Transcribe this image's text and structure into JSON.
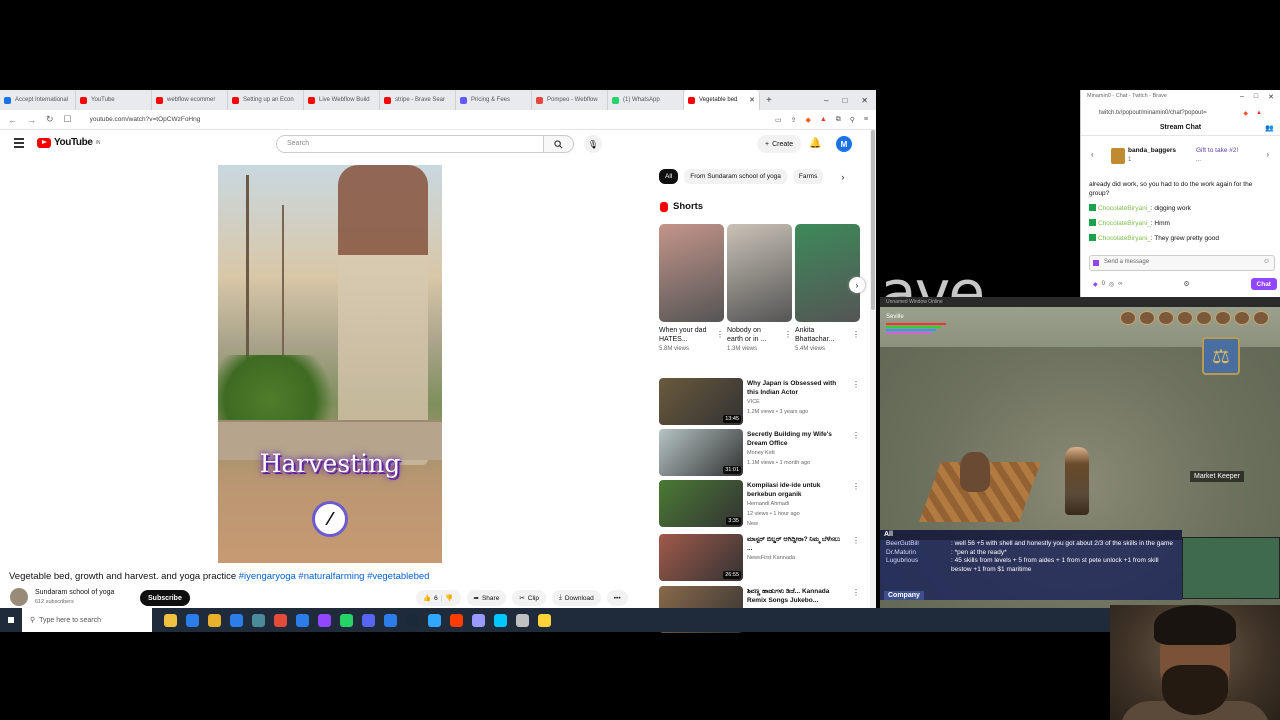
{
  "browser": {
    "tabs": [
      {
        "label": "Accept International",
        "color": "#1a73e8"
      },
      {
        "label": "YouTube",
        "color": "#ff0000"
      },
      {
        "label": "webflow ecommer",
        "color": "#ff0000"
      },
      {
        "label": "Setting up an Econ",
        "color": "#ff0000"
      },
      {
        "label": "Live Webflow Build",
        "color": "#ff0000"
      },
      {
        "label": "stripe - Brave Sear",
        "color": "#ff0000"
      },
      {
        "label": "Pricing & Fees",
        "color": "#635bff"
      },
      {
        "label": "Pompeo - Webflow",
        "color": "#e8453c"
      },
      {
        "label": "(1) WhatsApp",
        "color": "#25d366"
      },
      {
        "label": "Vegetable bed",
        "color": "#ff0000"
      }
    ],
    "url": "youtube.com/watch?v=tOpCWzFoHng",
    "window_controls": [
      "–",
      "□",
      "✕"
    ],
    "new_tab": "+"
  },
  "youtube": {
    "logo_text": "YouTube",
    "logo_sup": "IN",
    "search_placeholder": "Search",
    "create_label": "Create",
    "avatar_letter": "M",
    "video_overlay_text": "Harvesting",
    "video_title_plain": "Vegetable bed, growth and harvest. and yoga practice",
    "video_tags": "#iyengaryoga #naturalfarming #vegetablebed",
    "channel_name": "Sundaram school of yoga",
    "channel_subs": "612 subscribers",
    "subscribe_label": "Subscribe",
    "actions": {
      "like_count": "6",
      "share": "Share",
      "clip": "Clip",
      "download": "Download",
      "more": "•••"
    },
    "chips": [
      "All",
      "From Sundaram school of yoga",
      "Farms"
    ],
    "shorts_heading": "Shorts",
    "shorts": [
      {
        "title": "When your dad HATES...",
        "views": "5.8M views",
        "color": "#c4958a"
      },
      {
        "title": "Nobody on earth or in ...",
        "views": "1.3M views",
        "color": "#c9c2b6"
      },
      {
        "title": "Ankita Bhattachar...",
        "views": "5.4M views",
        "color": "#3d8a5a"
      }
    ],
    "recommendations": [
      {
        "title": "Why Japan is Obsessed with this Indian Actor",
        "channel": "VICE",
        "meta": "1.2M views • 3 years ago",
        "duration": "13:45",
        "color": "#6a5a3c"
      },
      {
        "title": "Secretly Building my Wife's Dream Office",
        "channel": "Money Kett",
        "meta": "1.1M views • 1 month ago",
        "duration": "31:01",
        "color": "#b6c4c4"
      },
      {
        "title": "Kompilasi ide-ide untuk berkebun organik",
        "channel": "Hernandi Ahmadi",
        "meta": "12 views • 1 hour ago",
        "duration": "3:35",
        "color": "#4a7a34",
        "badge": "New"
      },
      {
        "title": "ಮಾಸ್ಟರ್ ಬಿಲ್ಡರ್ ಆಗಿದ್ದೀರಾ? ನಿಮ್ಮ ಬೆಳೆಸಲು ...",
        "channel": "NewsFirst Kannada",
        "meta": "",
        "duration": "26:55",
        "color": "#a05a4a"
      },
      {
        "title": "ಶಿವಣ್ಣ ಹಾಡುಗಳು ಡಿಜೆ... Kannada Remix Songs Jukebo...",
        "channel": "",
        "meta": "",
        "duration": "",
        "color": "#8a6a4a"
      }
    ]
  },
  "twitch": {
    "window_title": "Minamin0 - Chat - Twitch - Brave",
    "url": "twitch.tv/popout/minamin0/chat?popout=",
    "header": "Stream Chat",
    "gift": {
      "user": "banda_baggers",
      "sub": "1",
      "message": "Gift to take #2!",
      "sub2": "..."
    },
    "messages": [
      {
        "user": "",
        "text": "already did work, so you had to do the work again for the group?"
      },
      {
        "user": "ChocolateBiryani_",
        "text": ": digging work"
      },
      {
        "user": "ChocolateBiryani_",
        "text": ": Hmm"
      },
      {
        "user": "ChocolateBiryani_",
        "text": ": They grew pretty good"
      }
    ],
    "input_placeholder": "Send a message",
    "points": "0",
    "chat_button": "Chat",
    "overflow_text": "ave"
  },
  "game": {
    "title_bar": "Unnamed Window Online",
    "player_name": "Seville",
    "chat_tab": "All",
    "chat_lines": [
      {
        "name": "BeerGutBill",
        "msg": ": well 56 +5 with shell and honestly you got about 2/3 of the skills in the game"
      },
      {
        "name": "Dr.Maturin",
        "msg": ": *pen at the ready*"
      },
      {
        "name": "Lugubrious",
        "msg": ": 45 skills from levels + 5 from aides + 1 from st pete unlock +1 from skill bestow +1 from $1 maritime"
      }
    ],
    "company_tab": "Company",
    "market_label": "Market Keeper"
  },
  "taskbar": {
    "search_placeholder": "Type here to search",
    "icons": [
      "#f0c040",
      "#2b7de9",
      "#e8b12a",
      "#2b7de9",
      "#4a8a9a",
      "#e34b3b",
      "#2b7de9",
      "#9146ff",
      "#25d366",
      "#5865f2",
      "#2b7de9",
      "#1a2a3a",
      "#31a8ff",
      "#ff3d00",
      "#9999ff",
      "#00c8ff",
      "#c0c0c0",
      "#ffd43b"
    ]
  }
}
